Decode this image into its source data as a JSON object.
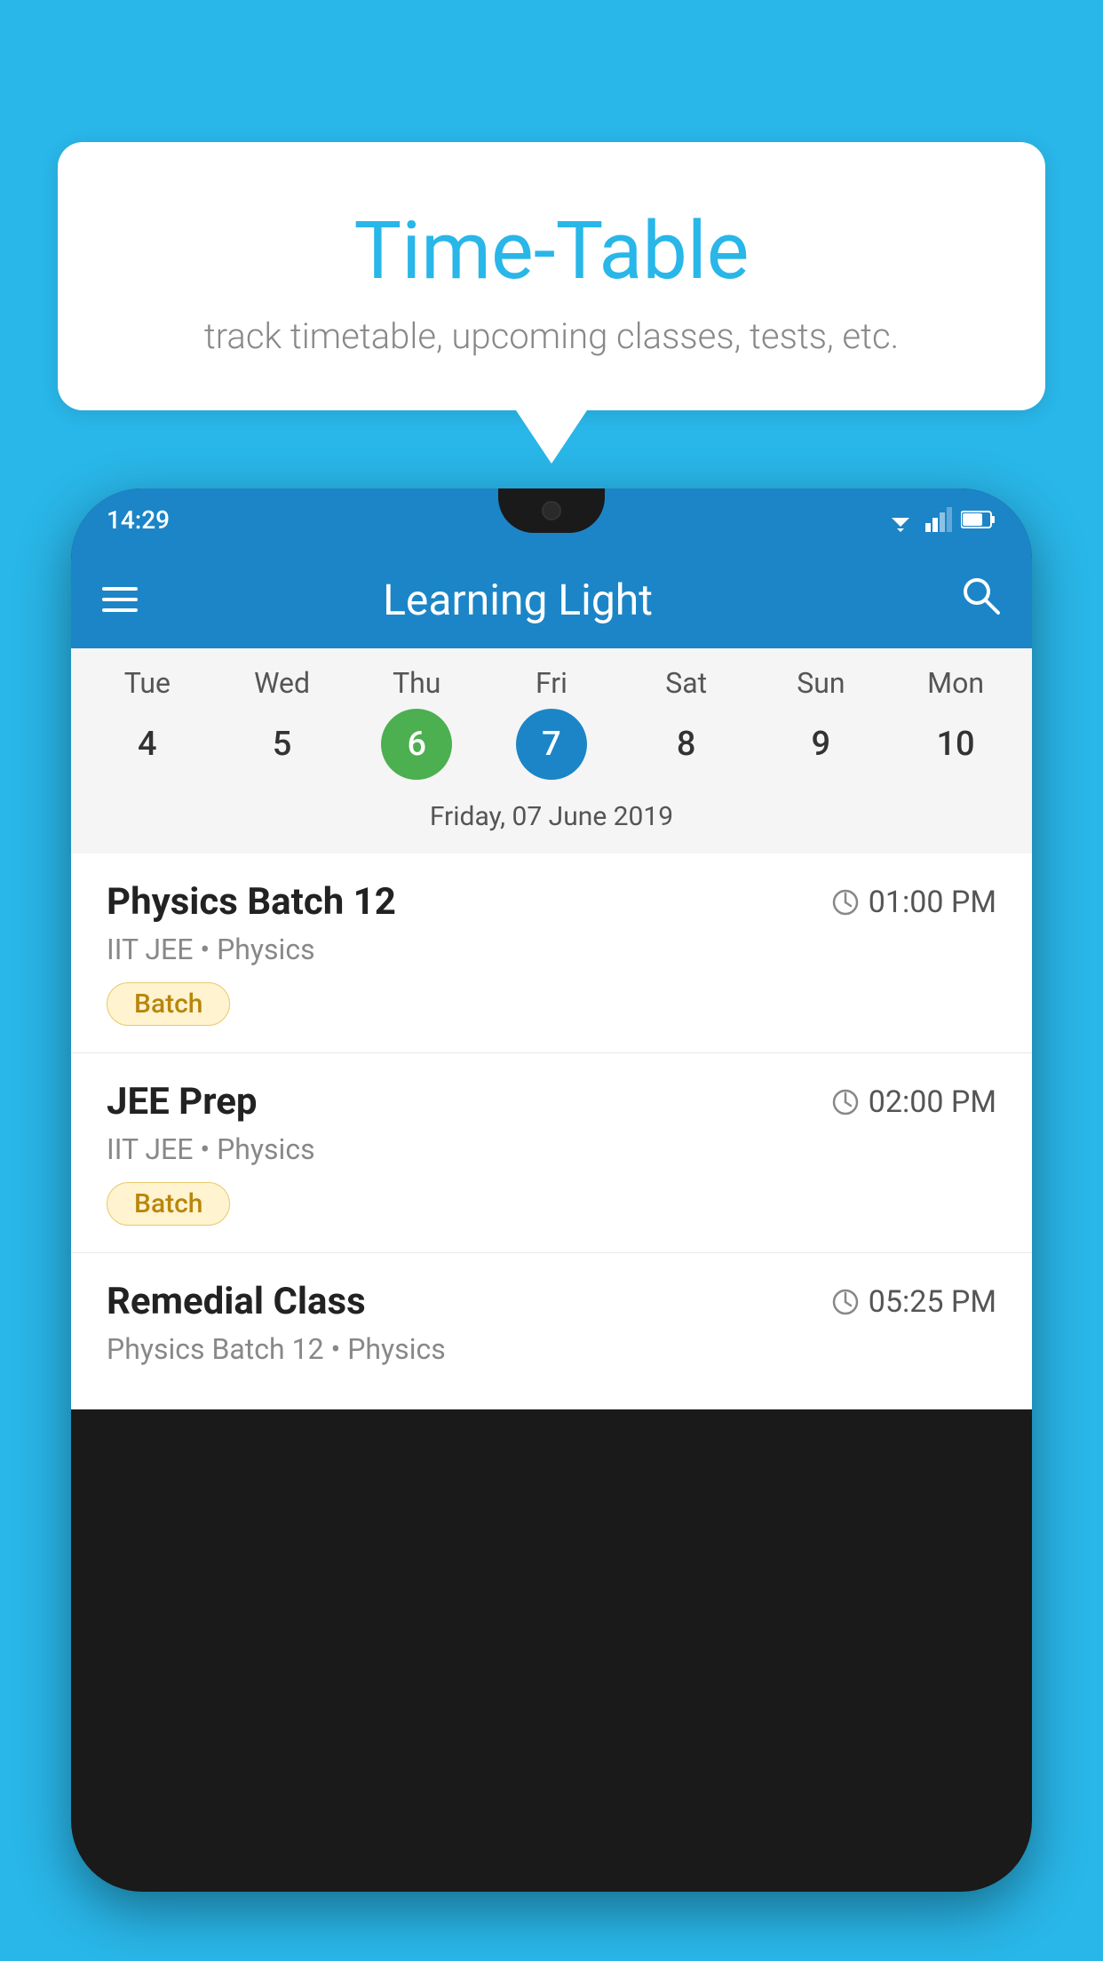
{
  "background_color": "#29b6e8",
  "bubble": {
    "title": "Time-Table",
    "subtitle": "track timetable, upcoming classes, tests, etc."
  },
  "status_bar": {
    "time": "14:29"
  },
  "app_bar": {
    "title": "Learning Light"
  },
  "calendar": {
    "days": [
      {
        "name": "Tue",
        "number": "4",
        "state": "normal"
      },
      {
        "name": "Wed",
        "number": "5",
        "state": "normal"
      },
      {
        "name": "Thu",
        "number": "6",
        "state": "today"
      },
      {
        "name": "Fri",
        "number": "7",
        "state": "selected"
      },
      {
        "name": "Sat",
        "number": "8",
        "state": "normal"
      },
      {
        "name": "Sun",
        "number": "9",
        "state": "normal"
      },
      {
        "name": "Mon",
        "number": "10",
        "state": "normal"
      }
    ],
    "selected_date_label": "Friday, 07 June 2019"
  },
  "schedule": [
    {
      "name": "Physics Batch 12",
      "time": "01:00 PM",
      "meta": "IIT JEE • Physics",
      "tag": "Batch"
    },
    {
      "name": "JEE Prep",
      "time": "02:00 PM",
      "meta": "IIT JEE • Physics",
      "tag": "Batch"
    },
    {
      "name": "Remedial Class",
      "time": "05:25 PM",
      "meta": "Physics Batch 12 • Physics",
      "tag": ""
    }
  ],
  "labels": {
    "menu": "menu",
    "search": "search"
  }
}
